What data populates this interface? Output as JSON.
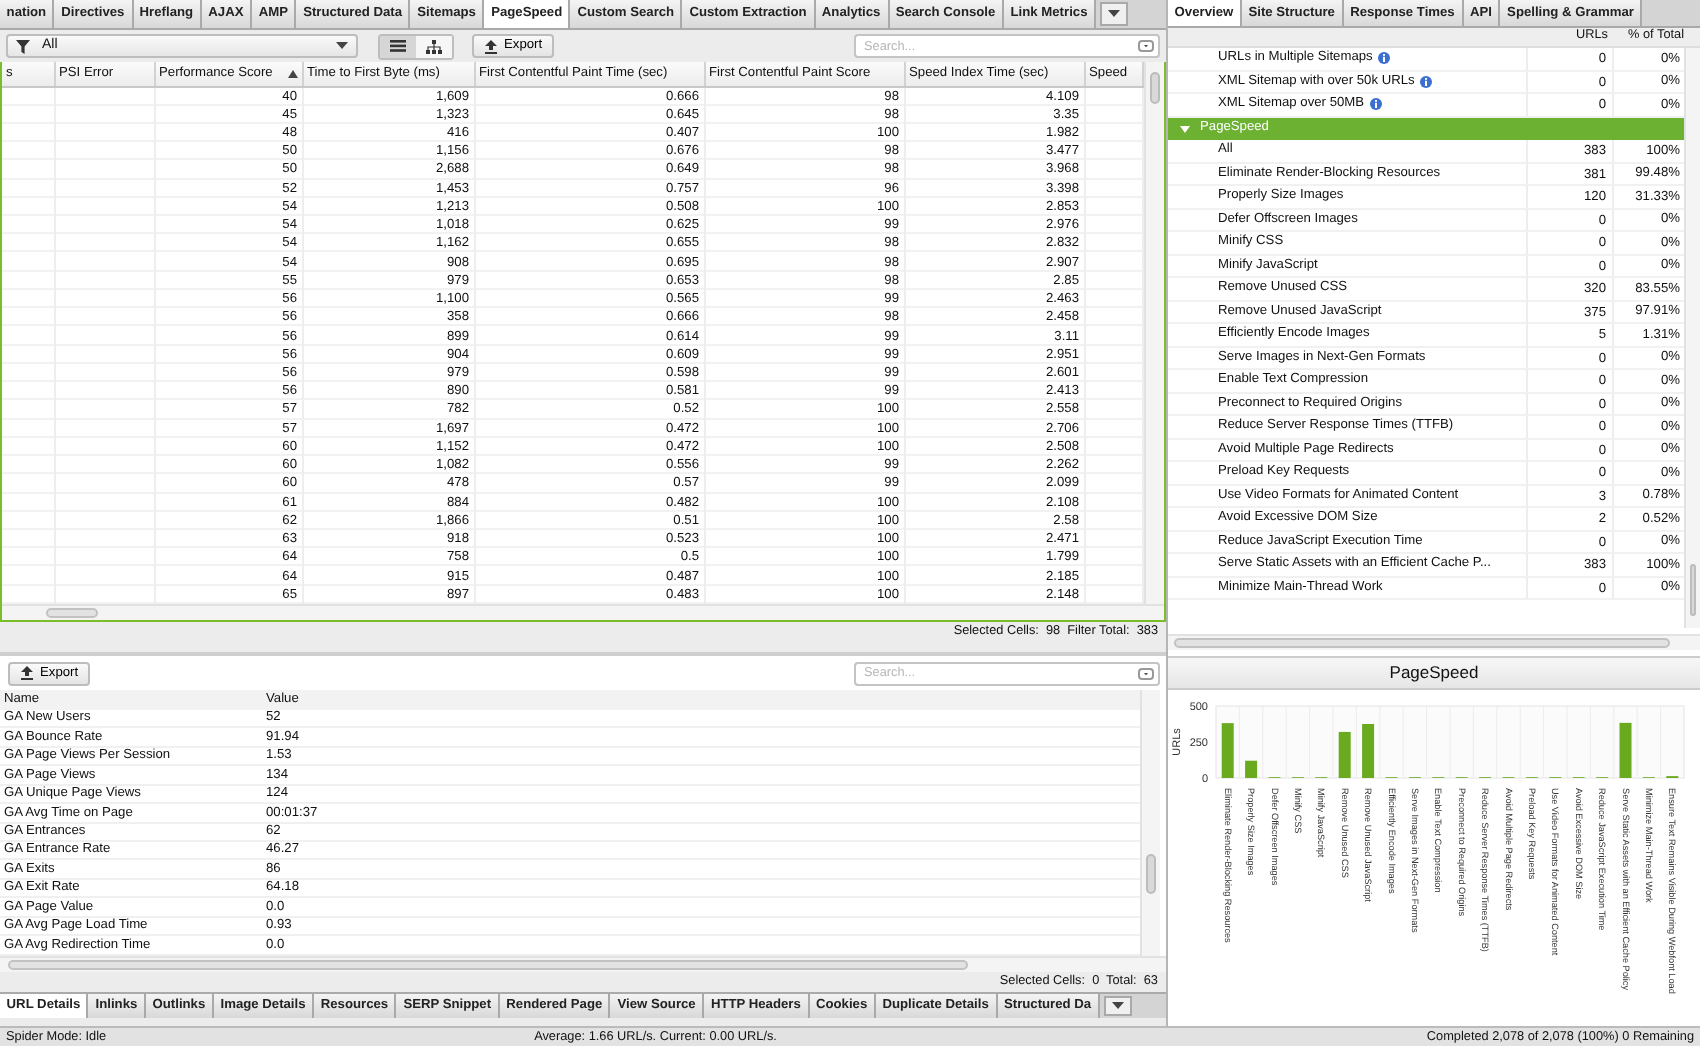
{
  "top_tabs": [
    {
      "label": "nation",
      "selected": false
    },
    {
      "label": "Directives",
      "selected": false
    },
    {
      "label": "Hreflang",
      "selected": false
    },
    {
      "label": "AJAX",
      "selected": false
    },
    {
      "label": "AMP",
      "selected": false
    },
    {
      "label": "Structured Data",
      "selected": false
    },
    {
      "label": "Sitemaps",
      "selected": false
    },
    {
      "label": "PageSpeed",
      "selected": true
    },
    {
      "label": "Custom Search",
      "selected": false
    },
    {
      "label": "Custom Extraction",
      "selected": false
    },
    {
      "label": "Analytics",
      "selected": false
    },
    {
      "label": "Search Console",
      "selected": false
    },
    {
      "label": "Link Metrics",
      "selected": false
    }
  ],
  "filter": {
    "value": "All"
  },
  "view_modes": [
    {
      "kind": "list",
      "selected": true
    },
    {
      "kind": "tree",
      "selected": false
    }
  ],
  "export_button": "Export",
  "search": {
    "placeholder": "Search..."
  },
  "main_table": {
    "columns": [
      {
        "label": "s",
        "sorted": false
      },
      {
        "label": "PSI Error",
        "sorted": false
      },
      {
        "label": "Performance Score",
        "sorted": true
      },
      {
        "label": "Time to First Byte (ms)",
        "sorted": false
      },
      {
        "label": "First Contentful Paint Time (sec)",
        "sorted": false
      },
      {
        "label": "First Contentful Paint Score",
        "sorted": false
      },
      {
        "label": "Speed Index Time (sec)",
        "sorted": false
      },
      {
        "label": "Speed",
        "sorted": false
      }
    ],
    "rows": [
      [
        "",
        "",
        "40",
        "1,609",
        "0.666",
        "98",
        "4.109",
        ""
      ],
      [
        "",
        "",
        "45",
        "1,323",
        "0.645",
        "98",
        "3.35",
        ""
      ],
      [
        "",
        "",
        "48",
        "416",
        "0.407",
        "100",
        "1.982",
        ""
      ],
      [
        "",
        "",
        "50",
        "1,156",
        "0.676",
        "98",
        "3.477",
        ""
      ],
      [
        "",
        "",
        "50",
        "2,688",
        "0.649",
        "98",
        "3.968",
        ""
      ],
      [
        "",
        "",
        "52",
        "1,453",
        "0.757",
        "96",
        "3.398",
        ""
      ],
      [
        "",
        "",
        "54",
        "1,213",
        "0.508",
        "100",
        "2.853",
        ""
      ],
      [
        "",
        "",
        "54",
        "1,018",
        "0.625",
        "99",
        "2.976",
        ""
      ],
      [
        "",
        "",
        "54",
        "1,162",
        "0.655",
        "98",
        "2.832",
        ""
      ],
      [
        "",
        "",
        "54",
        "908",
        "0.695",
        "98",
        "2.907",
        ""
      ],
      [
        "",
        "",
        "55",
        "979",
        "0.653",
        "98",
        "2.85",
        ""
      ],
      [
        "",
        "",
        "56",
        "1,100",
        "0.565",
        "99",
        "2.463",
        ""
      ],
      [
        "",
        "",
        "56",
        "358",
        "0.666",
        "98",
        "2.458",
        ""
      ],
      [
        "",
        "",
        "56",
        "899",
        "0.614",
        "99",
        "3.11",
        ""
      ],
      [
        "",
        "",
        "56",
        "904",
        "0.609",
        "99",
        "2.951",
        ""
      ],
      [
        "",
        "",
        "56",
        "979",
        "0.598",
        "99",
        "2.601",
        ""
      ],
      [
        "",
        "",
        "56",
        "890",
        "0.581",
        "99",
        "2.413",
        ""
      ],
      [
        "",
        "",
        "57",
        "782",
        "0.52",
        "100",
        "2.558",
        ""
      ],
      [
        "",
        "",
        "57",
        "1,697",
        "0.472",
        "100",
        "2.706",
        ""
      ],
      [
        "",
        "",
        "60",
        "1,152",
        "0.472",
        "100",
        "2.508",
        ""
      ],
      [
        "",
        "",
        "60",
        "1,082",
        "0.556",
        "99",
        "2.262",
        ""
      ],
      [
        "",
        "",
        "60",
        "478",
        "0.57",
        "99",
        "2.099",
        ""
      ],
      [
        "",
        "",
        "61",
        "884",
        "0.482",
        "100",
        "2.108",
        ""
      ],
      [
        "",
        "",
        "62",
        "1,866",
        "0.51",
        "100",
        "2.58",
        ""
      ],
      [
        "",
        "",
        "63",
        "918",
        "0.523",
        "100",
        "2.471",
        ""
      ],
      [
        "",
        "",
        "64",
        "758",
        "0.5",
        "100",
        "1.799",
        ""
      ],
      [
        "",
        "",
        "64",
        "915",
        "0.487",
        "100",
        "2.185",
        ""
      ],
      [
        "",
        "",
        "65",
        "897",
        "0.483",
        "100",
        "2.148",
        ""
      ]
    ]
  },
  "main_status": "Selected Cells:  98  Filter Total:  383",
  "details": {
    "export_button": "Export",
    "search": {
      "placeholder": "Search..."
    },
    "columns": [
      "Name",
      "Value"
    ],
    "rows": [
      [
        "GA New Users",
        "52"
      ],
      [
        "GA Bounce Rate",
        "91.94"
      ],
      [
        "GA Page Views Per Session",
        "1.53"
      ],
      [
        "GA Page Views",
        "134"
      ],
      [
        "GA Unique Page Views",
        "124"
      ],
      [
        "GA Avg Time on Page",
        "00:01:37"
      ],
      [
        "GA Entrances",
        "62"
      ],
      [
        "GA Entrance Rate",
        "46.27"
      ],
      [
        "GA Exits",
        "86"
      ],
      [
        "GA Exit Rate",
        "64.18"
      ],
      [
        "GA Page Value",
        "0.0"
      ],
      [
        "GA Avg Page Load Time",
        "0.93"
      ],
      [
        "GA Avg Redirection Time",
        "0.0"
      ]
    ],
    "status": "Selected Cells:  0  Total:  63"
  },
  "bottom_tabs": [
    {
      "label": "URL Details",
      "selected": true
    },
    {
      "label": "Inlinks",
      "selected": false
    },
    {
      "label": "Outlinks",
      "selected": false
    },
    {
      "label": "Image Details",
      "selected": false
    },
    {
      "label": "Resources",
      "selected": false
    },
    {
      "label": "SERP Snippet",
      "selected": false
    },
    {
      "label": "Rendered Page",
      "selected": false
    },
    {
      "label": "View Source",
      "selected": false
    },
    {
      "label": "HTTP Headers",
      "selected": false
    },
    {
      "label": "Cookies",
      "selected": false
    },
    {
      "label": "Duplicate Details",
      "selected": false
    },
    {
      "label": "Structured Da",
      "selected": false
    }
  ],
  "right_tabs": [
    {
      "label": "Overview",
      "selected": true
    },
    {
      "label": "Site Structure",
      "selected": false
    },
    {
      "label": "Response Times",
      "selected": false
    },
    {
      "label": "API",
      "selected": false
    },
    {
      "label": "Spelling & Grammar",
      "selected": false
    }
  ],
  "overview": {
    "columns": [
      "URLs",
      "% of Total"
    ],
    "rows": [
      {
        "label": "URLs in Multiple Sitemaps",
        "urls": "0",
        "pct": "0%",
        "info": true
      },
      {
        "label": "XML Sitemap with over 50k URLs",
        "urls": "0",
        "pct": "0%",
        "info": true
      },
      {
        "label": "XML Sitemap over 50MB",
        "urls": "0",
        "pct": "0%",
        "info": true
      }
    ],
    "group": {
      "label": "PageSpeed",
      "expanded": true,
      "selected": true,
      "children": [
        {
          "label": "All",
          "urls": "383",
          "pct": "100%"
        },
        {
          "label": "Eliminate Render-Blocking Resources",
          "urls": "381",
          "pct": "99.48%"
        },
        {
          "label": "Properly Size Images",
          "urls": "120",
          "pct": "31.33%"
        },
        {
          "label": "Defer Offscreen Images",
          "urls": "0",
          "pct": "0%"
        },
        {
          "label": "Minify CSS",
          "urls": "0",
          "pct": "0%"
        },
        {
          "label": "Minify JavaScript",
          "urls": "0",
          "pct": "0%"
        },
        {
          "label": "Remove Unused CSS",
          "urls": "320",
          "pct": "83.55%"
        },
        {
          "label": "Remove Unused JavaScript",
          "urls": "375",
          "pct": "97.91%"
        },
        {
          "label": "Efficiently Encode Images",
          "urls": "5",
          "pct": "1.31%"
        },
        {
          "label": "Serve Images in Next-Gen Formats",
          "urls": "0",
          "pct": "0%"
        },
        {
          "label": "Enable Text Compression",
          "urls": "0",
          "pct": "0%"
        },
        {
          "label": "Preconnect to Required Origins",
          "urls": "0",
          "pct": "0%"
        },
        {
          "label": "Reduce Server Response Times (TTFB)",
          "urls": "0",
          "pct": "0%"
        },
        {
          "label": "Avoid Multiple Page Redirects",
          "urls": "0",
          "pct": "0%"
        },
        {
          "label": "Preload Key Requests",
          "urls": "0",
          "pct": "0%"
        },
        {
          "label": "Use Video Formats for Animated Content",
          "urls": "3",
          "pct": "0.78%"
        },
        {
          "label": "Avoid Excessive DOM Size",
          "urls": "2",
          "pct": "0.52%"
        },
        {
          "label": "Reduce JavaScript Execution Time",
          "urls": "0",
          "pct": "0%"
        },
        {
          "label": "Serve Static Assets with an Efficient Cache P...",
          "urls": "383",
          "pct": "100%"
        },
        {
          "label": "Minimize Main-Thread Work",
          "urls": "0",
          "pct": "0%"
        }
      ]
    }
  },
  "chart": {
    "chart_data": {
      "type": "bar",
      "title": "PageSpeed",
      "ylabel": "URLs",
      "categories": [
        "Eliminate Render-Blocking Resources",
        "Properly Size Images",
        "Defer Offscreen Images",
        "Minify CSS",
        "Minify JavaScript",
        "Remove Unused CSS",
        "Remove Unused JavaScript",
        "Efficiently Encode Images",
        "Serve Images in Next-Gen Formats",
        "Enable Text Compression",
        "Preconnect to Required Origins",
        "Reduce Server Response Times (TTFB)",
        "Avoid Multiple Page Redirects",
        "Preload Key Requests",
        "Use Video Formats for Animated Content",
        "Avoid Excessive DOM Size",
        "Reduce JavaScript Execution Time",
        "Serve Static Assets with an Efficient Cache Policy",
        "Minimize Main-Thread Work",
        "Ensure Text Remains Visible During Webfont Load"
      ],
      "series": [
        {
          "color": "#6aaa1e",
          "values": [
            381,
            120,
            0,
            0,
            0,
            320,
            375,
            5,
            0,
            0,
            0,
            0,
            0,
            0,
            3,
            2,
            0,
            383,
            0,
            13
          ]
        }
      ],
      "ylim": [
        0,
        500
      ],
      "yticks": [
        0,
        250,
        500
      ]
    }
  },
  "status_bar": {
    "mode": "Spider Mode: Idle",
    "speed": "Average: 1.66 URL/s. Current: 0.00 URL/s.",
    "progress": "Completed 2,078 of 2,078 (100%) 0 Remaining"
  }
}
